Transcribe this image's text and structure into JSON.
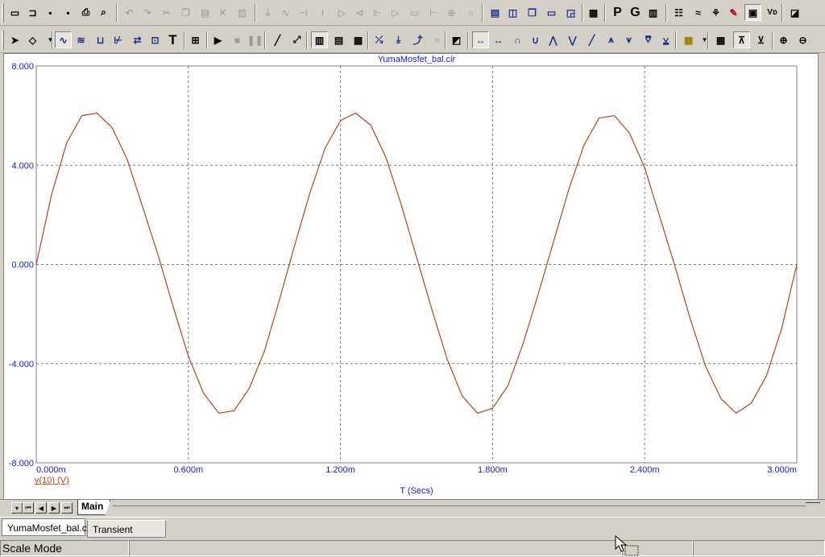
{
  "toolbar_top": {
    "icons": [
      "new-file-icon",
      "open-file-icon",
      "save-icon",
      "save-all-icon",
      "print-icon",
      "print-preview-icon",
      "undo-icon",
      "redo-icon",
      "cut-icon",
      "copy-icon",
      "paste-icon",
      "delete-icon",
      "select-all-icon",
      "ground-icon",
      "resistor-icon",
      "capacitor-icon",
      "inductor-icon",
      "diode-icon",
      "transistor-icon",
      "mosfet-icon",
      "opamp-icon",
      "source-icon",
      "battery-icon",
      "probe-icon",
      "meter-icon",
      "split-horizontal-icon",
      "split-vertical-icon",
      "cascade-icon",
      "window-icon",
      "tile-icon",
      "calculator-icon",
      "text-icon",
      "graph-icon",
      "component-icon",
      "scope-icon",
      "wave-icon",
      "grid-icon",
      "marker-icon",
      "monitor-icon",
      "properties-icon",
      "preview-icon"
    ],
    "letter_p": "P",
    "letter_g": "G"
  },
  "toolbar_plot": {
    "icons": [
      "select-arrow-icon",
      "component-select-icon",
      "scale-mode-icon",
      "wave-mode-icon",
      "cursor-mode-icon",
      "point-tag-icon",
      "horizontal-tag-icon",
      "performance-tag-icon",
      "text-icon",
      "properties-icon",
      "run-icon",
      "stop-icon",
      "pause-icon",
      "line-icon",
      "diagonal-icon",
      "grid-heavy-icon",
      "grid-dense-icon",
      "grid-dots-icon",
      "peak-icon",
      "valley-icon",
      "slope-icon",
      "wave-shape-icon",
      "scope-icon",
      "left-cursor-icon",
      "right-cursor-icon",
      "peak-wave-icon",
      "valley-wave-icon",
      "high-icon",
      "low-icon",
      "inflection-icon",
      "global-high-icon",
      "global-low-icon",
      "top-icon",
      "bottom-icon",
      "package-icon",
      "data-table-icon",
      "tokens-icon",
      "stepping-icon",
      "zoom-in-icon",
      "zoom-out-icon"
    ],
    "text_tool": "T"
  },
  "plot": {
    "title": "YumaMosfet_bal.cir",
    "xlabel": "T (Secs)",
    "series_label": "v(10) (V)",
    "x_ticks": [
      "0.000m",
      "0.600m",
      "1.200m",
      "1.800m",
      "2.400m",
      "3.000m"
    ],
    "y_ticks": [
      "8.000",
      "4.000",
      "0.000",
      "-4.000",
      "-8.000"
    ]
  },
  "chart_data": {
    "type": "line",
    "title": "YumaMosfet_bal.cir",
    "xlabel": "T (Secs)",
    "ylabel": "",
    "xlim": [
      0,
      3.0
    ],
    "x_unit": "ms",
    "ylim": [
      -8,
      8
    ],
    "grid": true,
    "series": [
      {
        "name": "v(10) (V)",
        "color": "#b5451b",
        "x": [
          0.0,
          0.06,
          0.12,
          0.18,
          0.24,
          0.3,
          0.36,
          0.42,
          0.48,
          0.54,
          0.6,
          0.66,
          0.72,
          0.78,
          0.84,
          0.9,
          0.96,
          1.02,
          1.08,
          1.14,
          1.2,
          1.26,
          1.32,
          1.38,
          1.44,
          1.5,
          1.56,
          1.62,
          1.68,
          1.74,
          1.8,
          1.86,
          1.92,
          1.98,
          2.04,
          2.1,
          2.16,
          2.22,
          2.28,
          2.34,
          2.4,
          2.46,
          2.52,
          2.58,
          2.64,
          2.7,
          2.76,
          2.82,
          2.88,
          2.94,
          3.0
        ],
        "values": [
          0.0,
          2.8,
          4.9,
          6.0,
          6.1,
          5.5,
          4.2,
          2.3,
          0.4,
          -1.7,
          -3.7,
          -5.2,
          -6.0,
          -5.9,
          -5.0,
          -3.5,
          -1.4,
          0.8,
          2.9,
          4.7,
          5.8,
          6.1,
          5.6,
          4.3,
          2.4,
          0.3,
          -1.8,
          -3.8,
          -5.3,
          -6.0,
          -5.8,
          -4.9,
          -3.2,
          -1.2,
          0.9,
          3.0,
          4.8,
          5.9,
          6.0,
          5.3,
          3.9,
          1.9,
          -0.1,
          -2.2,
          -4.1,
          -5.4,
          -6.0,
          -5.6,
          -4.5,
          -2.6,
          0.0
        ]
      }
    ]
  },
  "bottom": {
    "active_page_tab": "Main"
  },
  "window_tabs": [
    {
      "label": "YumaMosfet_bal.cir"
    },
    {
      "label": "Transient Analysis"
    }
  ],
  "statusbar": {
    "mode": "Scale Mode"
  }
}
